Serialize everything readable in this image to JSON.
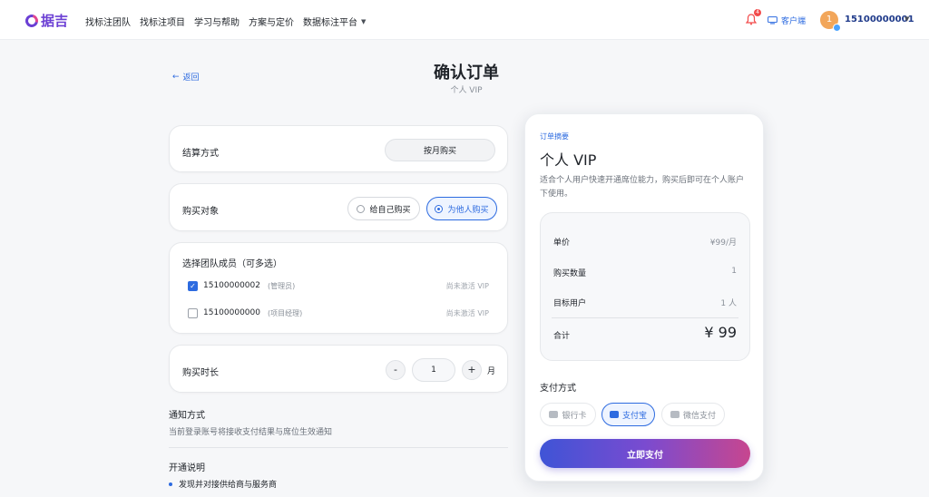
{
  "brand": {
    "name": "据吉"
  },
  "nav": {
    "items": [
      "找标注团队",
      "找标注项目",
      "学习与帮助",
      "方案与定价"
    ],
    "dropdown": "数据标注平台",
    "bell_count": "4",
    "client_label": "客户端",
    "avatar_letter": "1",
    "username": "15100000001"
  },
  "header": {
    "back": "返回",
    "title": "确认订单",
    "subtitle": "个人 VIP"
  },
  "settlement": {
    "label": "结算方式",
    "option": "按月购买"
  },
  "purchase_target": {
    "label": "购买对象",
    "options": [
      {
        "label": "给自己购买",
        "selected": false
      },
      {
        "label": "为他人购买",
        "selected": true
      }
    ]
  },
  "members": {
    "label": "选择团队成员（可多选）",
    "rows": [
      {
        "id": "15100000002",
        "role": "(管理员)",
        "status": "尚未激活 VIP",
        "checked": true
      },
      {
        "id": "15100000000",
        "role": "(项目经理)",
        "status": "尚未激活 VIP",
        "checked": false
      }
    ]
  },
  "duration": {
    "label": "购买时长",
    "minus": "-",
    "value": "1",
    "plus": "+",
    "unit": "月"
  },
  "notice": {
    "title": "通知方式",
    "text": "当前登录账号将接收支付结果与席位生效通知"
  },
  "open_info": {
    "title": "开通说明",
    "bullets": [
      "发现并对接供给商与服务商"
    ]
  },
  "summary": {
    "tag": "订单摘要",
    "title": "个人 VIP",
    "description": "适合个人用户快速开通席位能力，购买后即可在个人账户下使用。",
    "rows": [
      {
        "label": "单价",
        "value": "¥99/月"
      },
      {
        "label": "购买数量",
        "value": "1"
      },
      {
        "label": "目标用户",
        "value": "1 人"
      }
    ],
    "total_label": "合计",
    "total_value": "¥ 99",
    "pay_title": "支付方式",
    "pay_options": [
      {
        "label": "银行卡",
        "selected": false
      },
      {
        "label": "支付宝",
        "selected": true
      },
      {
        "label": "微信支付",
        "selected": false
      }
    ],
    "pay_button": "立即支付"
  },
  "colors": {
    "accent": "#2d6be0",
    "brand": "#6b3fd4",
    "badge": "#f24a4a"
  }
}
